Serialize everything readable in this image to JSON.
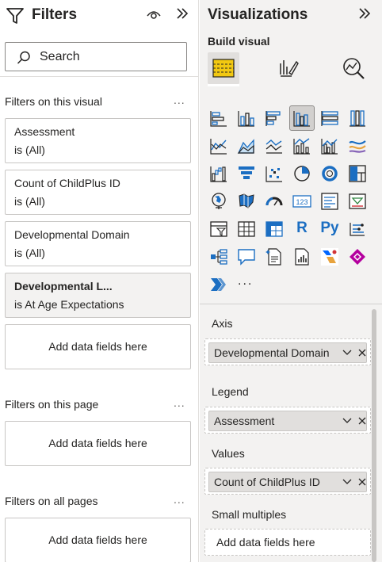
{
  "filters_pane": {
    "title": "Filters",
    "search_placeholder": "Search",
    "sections": {
      "visual": "Filters on this visual",
      "page": "Filters on this page",
      "all_pages": "Filters on all pages"
    },
    "more_label": "...",
    "cards": [
      {
        "name": "Assessment",
        "value": "is (All)"
      },
      {
        "name": "Count of ChildPlus ID",
        "value": "is (All)"
      },
      {
        "name": "Developmental Domain",
        "value": "is (All)"
      },
      {
        "name": "Developmental L...",
        "value": "is At Age Expectations"
      }
    ],
    "add_data_label": "Add data fields here"
  },
  "viz_pane": {
    "title": "Visualizations",
    "build_label": "Build visual",
    "more_visuals": "...",
    "wells": [
      {
        "label": "Axis",
        "field": "Developmental Domain"
      },
      {
        "label": "Legend",
        "field": "Assessment"
      },
      {
        "label": "Values",
        "field": "Count of ChildPlus ID"
      },
      {
        "label": "Small multiples",
        "field": "Add data fields here"
      }
    ],
    "glyphs": {
      "r": "R",
      "py": "Py"
    }
  },
  "colors": {
    "pane_bg": "#f3f2f1",
    "accent_blue": "#1b6ec2",
    "accent_yellow": "#f2c811",
    "border": "#c8c6c4"
  }
}
